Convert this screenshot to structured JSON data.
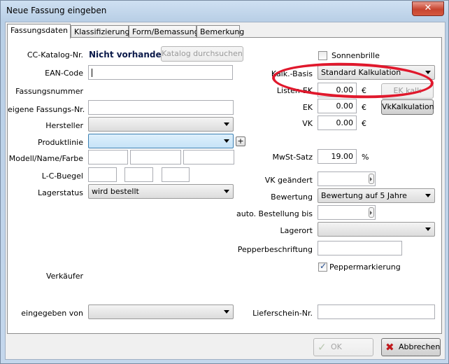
{
  "window": {
    "title": "Neue Fassung eingeben",
    "close_glyph": "✕"
  },
  "tabs": [
    "Fassungsdaten",
    "Klassifizierung",
    "Form/Bemassung",
    "Bemerkung"
  ],
  "left": {
    "cc_katalog": {
      "label": "CC-Katalog-Nr.",
      "value": "Nicht vorhanden",
      "button": "Katalog durchsuchen"
    },
    "ean": {
      "label": "EAN-Code",
      "value": ""
    },
    "fassungsnummer": {
      "label": "Fassungsnummer"
    },
    "eigene": {
      "label": "eigene Fassungs-Nr.",
      "value": ""
    },
    "hersteller": {
      "label": "Hersteller",
      "value": ""
    },
    "produktlinie": {
      "label": "Produktlinie",
      "value": "",
      "plus": "+"
    },
    "modell": {
      "label": "Modell/Name/Farbe"
    },
    "lcbuegel": {
      "label": "L-C-Buegel"
    },
    "lagerstatus": {
      "label": "Lagerstatus",
      "value": "wird bestellt"
    },
    "verkaeufer": {
      "label": "Verkäufer"
    },
    "eingegeben": {
      "label": "eingegeben von",
      "value": ""
    }
  },
  "right": {
    "sonnenbrille": {
      "label": "Sonnenbrille",
      "checked": false
    },
    "kalk_basis": {
      "label": "Kalk.-Basis",
      "value": "Standard Kalkulation"
    },
    "listen_ek": {
      "label": "Listen-EK",
      "value": "0.00",
      "unit": "€",
      "button": "EK kalk"
    },
    "ek": {
      "label": "EK",
      "value": "0.00",
      "unit": "€",
      "button": "VkKalkulation"
    },
    "vk": {
      "label": "VK",
      "value": "0.00",
      "unit": "€"
    },
    "mwst": {
      "label": "MwSt-Satz",
      "value": "19.00",
      "unit": "%"
    },
    "vk_geaendert": {
      "label": "VK geändert",
      "value": ""
    },
    "bewertung": {
      "label": "Bewertung",
      "value": "Bewertung auf 5 Jahre"
    },
    "auto_bestellung": {
      "label": "auto. Bestellung bis",
      "value": ""
    },
    "lagerort": {
      "label": "Lagerort",
      "value": ""
    },
    "pepperbeschriftung": {
      "label": "Pepperbeschriftung",
      "value": ""
    },
    "peppermarkierung": {
      "label": "Peppermarkierung",
      "checked": true
    },
    "lieferschein": {
      "label": "Lieferschein-Nr.",
      "value": ""
    }
  },
  "footer": {
    "ok": "OK",
    "cancel": "Abbrechen",
    "ok_icon": "✓",
    "cancel_icon": "✖"
  },
  "colors": {
    "highlight_oval": "#e0182c",
    "cancel_icon": "#c0181c"
  }
}
